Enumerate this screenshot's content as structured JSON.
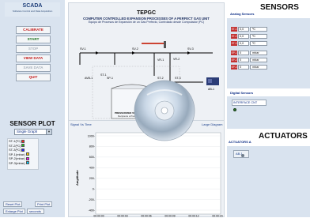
{
  "logo": {
    "title": "SCADA",
    "subtitle": "Software Control and Data Acquisition"
  },
  "buttons": {
    "calibrate": "CALIBRATE",
    "start": "START",
    "stop": "STOP",
    "view_data": "VIEW DATA",
    "save_data": "SAVE DATA",
    "quit": "QUIT"
  },
  "sensor_plot": {
    "title": "SENSOR PLOT",
    "graph_select": "Single Graph",
    "legend": [
      {
        "label": "ST-1(ºC)",
        "color": "#ff2020"
      },
      {
        "label": "ST-2(ºC)",
        "color": "#20c020"
      },
      {
        "label": "ST-3(ºC)",
        "color": "#2020ff"
      },
      {
        "label": "SP-1(mbar)",
        "color": "#ffcc00"
      },
      {
        "label": "SP-2(mbar)",
        "color": "#ff00ff"
      },
      {
        "label": "SP-3(mbar)",
        "color": "#00d0ff"
      }
    ]
  },
  "bottom_buttons": {
    "reset_plot": "Reset Plot",
    "print_plot": "Print Plot",
    "enlarge_plot": "Enlarge Plot",
    "seconds": "seconds"
  },
  "diagram": {
    "title": "TEPGC",
    "subtitle": "COMPUTER CONTROLLED EXPANSION PROCESSES OF A PERFECT GAS UNIT",
    "subtitle2": "Equipo de Procesos de Expansión de un Gas Perfecto, Controlado desde Computador (PC)",
    "vessel_label": "PRESSURIZED VESSEL",
    "vessel_sublabel": "Recipiente a Presión",
    "tags": [
      "SV-1",
      "SV-2",
      "SV-3",
      "VR-1",
      "VR-2",
      "AVB-1",
      "ST-1",
      "SP-1",
      "ST-2",
      "SP-2",
      "ST-3",
      "SP-3",
      "AB-1"
    ]
  },
  "graph": {
    "tab_left": "Signal Vs Time",
    "tab_right": "Large Diagram",
    "ylabel": "Amplitude",
    "y_ticks": [
      "1000-",
      "800-",
      "600-",
      "400-",
      "200-",
      "0-",
      "-200-",
      "-400-"
    ],
    "x_ticks": [
      "00:00:00",
      "00:00:03",
      "00:00:06",
      "00:00:09",
      "00:00:12",
      "00:00:15"
    ]
  },
  "analog_sensors": {
    "header": "SENSORS",
    "subheader": "Analog Sensors",
    "rows": [
      {
        "tag": "ST-1",
        "value": "0,0",
        "unit": "ºC"
      },
      {
        "tag": "ST-2",
        "value": "0,0",
        "unit": "ºC"
      },
      {
        "tag": "ST-3",
        "value": "0,0",
        "unit": "ºC"
      },
      {
        "tag": "SP-1",
        "value": "0",
        "unit": "mbar"
      },
      {
        "tag": "SP-2",
        "value": "0",
        "unit": "mbar"
      },
      {
        "tag": "SP-3",
        "value": "0",
        "unit": "mbar"
      }
    ]
  },
  "digital_sensors": {
    "subheader": "Digital Sensors",
    "interface": "INTERFACE CNT"
  },
  "actuators": {
    "header": "ACTUATORS",
    "subheader": "ACTUATORS A",
    "button": "AB-1"
  }
}
